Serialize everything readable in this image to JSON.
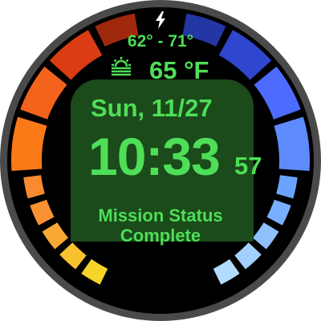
{
  "status_bar": {
    "charging_icon": "lightning-bolt-icon"
  },
  "weather": {
    "temp_range": "62° - 71°",
    "icon": "sunrise-icon",
    "current_temp": "65 °F"
  },
  "datetime": {
    "date": "Sun, 11/27",
    "time": "10:33",
    "seconds": "57"
  },
  "status": {
    "line1": "Mission Status",
    "line2": "Complete"
  },
  "colors": {
    "text_green": "#4ede57",
    "panel_green": "#1b4a1b",
    "bezel": "#4a4a4a",
    "dial": "#000000"
  },
  "gauges": {
    "left": {
      "segments": 10,
      "colors": [
        "#f6d42a",
        "#f8c22e",
        "#f9a833",
        "#f99233",
        "#f98a30",
        "#fb7a18",
        "#f4631b",
        "#db3c14",
        "#a0280c",
        "#7a1a0d"
      ]
    },
    "right": {
      "segments": 10,
      "colors": [
        "#b2dcff",
        "#a3d0ff",
        "#8fc0ff",
        "#7aafff",
        "#6aa3ff",
        "#5e8cff",
        "#4d6bff",
        "#2f47cf",
        "#2236a4",
        "#1b2a8a"
      ]
    }
  }
}
